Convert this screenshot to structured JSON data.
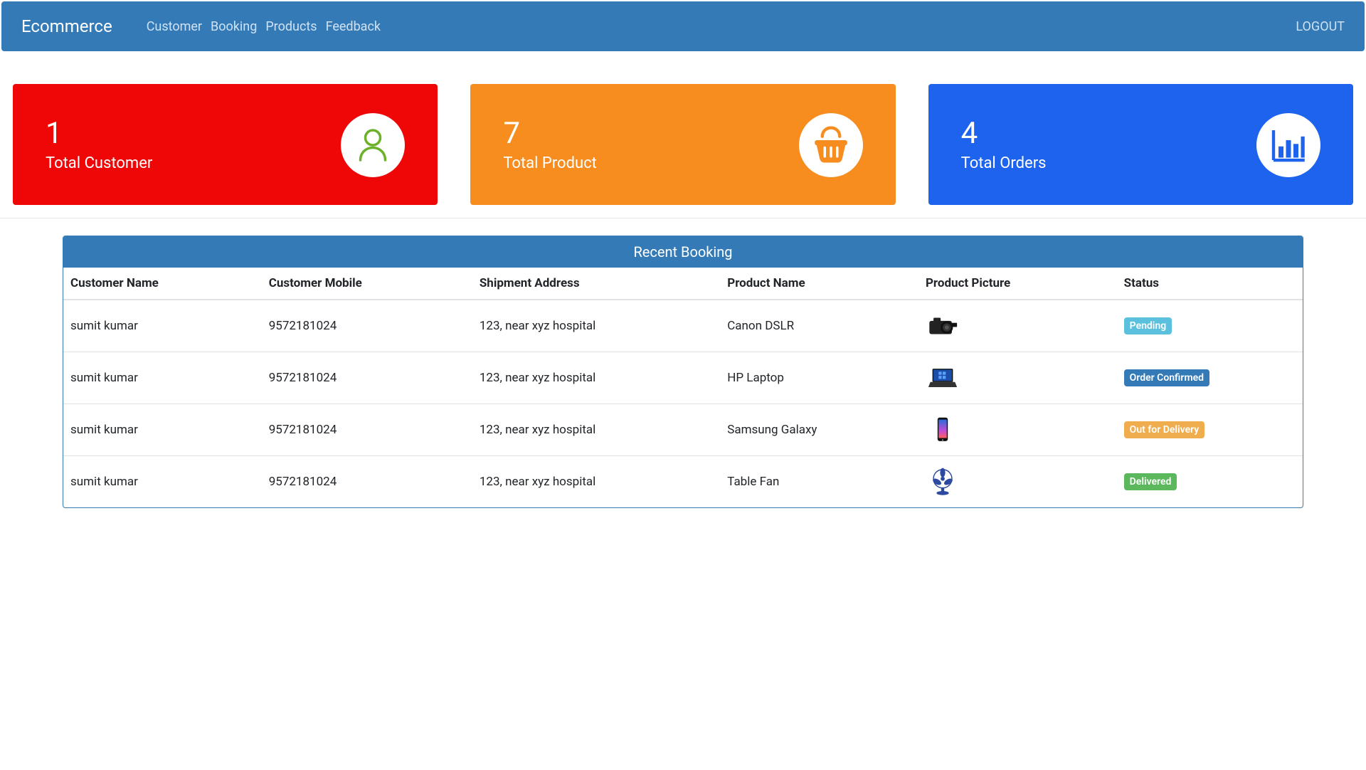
{
  "nav": {
    "brand": "Ecommerce",
    "links": [
      "Customer",
      "Booking",
      "Products",
      "Feedback"
    ],
    "logout": "LOGOUT"
  },
  "stats": [
    {
      "value": "1",
      "label": "Total Customer",
      "color": "red",
      "icon": "user"
    },
    {
      "value": "7",
      "label": "Total Product",
      "color": "orange",
      "icon": "basket"
    },
    {
      "value": "4",
      "label": "Total Orders",
      "color": "blue",
      "icon": "chart"
    }
  ],
  "panel": {
    "title": "Recent Booking",
    "columns": [
      "Customer Name",
      "Customer Mobile",
      "Shipment Address",
      "Product Name",
      "Product Picture",
      "Status"
    ],
    "rows": [
      {
        "name": "sumit kumar",
        "mobile": "9572181024",
        "address": "123, near xyz hospital",
        "product": "Canon DSLR",
        "pic": "camera",
        "status": "Pending",
        "statusClass": "pending"
      },
      {
        "name": "sumit kumar",
        "mobile": "9572181024",
        "address": "123, near xyz hospital",
        "product": "HP Laptop",
        "pic": "laptop",
        "status": "Order Confirmed",
        "statusClass": "confirmed"
      },
      {
        "name": "sumit kumar",
        "mobile": "9572181024",
        "address": "123, near xyz hospital",
        "product": "Samsung Galaxy",
        "pic": "phone",
        "status": "Out for Delivery",
        "statusClass": "out"
      },
      {
        "name": "sumit kumar",
        "mobile": "9572181024",
        "address": "123, near xyz hospital",
        "product": "Table Fan",
        "pic": "fan",
        "status": "Delivered",
        "statusClass": "delivered"
      }
    ]
  },
  "icons": {
    "user": "user-icon",
    "basket": "basket-icon",
    "chart": "chart-icon"
  },
  "colors": {
    "navbar": "#337ab7",
    "card_red": "#ef0707",
    "card_orange": "#f78c1f",
    "card_blue": "#1d63ed",
    "badge_info": "#5bc0de",
    "badge_primary": "#337ab7",
    "badge_warning": "#f0ad4e",
    "badge_success": "#5cb85c"
  }
}
